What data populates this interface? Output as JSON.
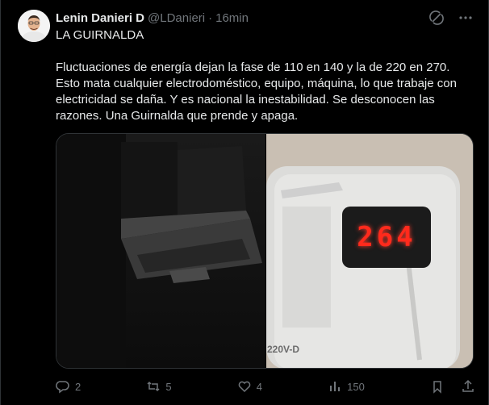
{
  "author": {
    "name": "Lenin Danieri D",
    "handle": "@LDanieri",
    "separator": "·",
    "time": "16min"
  },
  "tweet": {
    "title": "LA GUIRNALDA",
    "body": "Fluctuaciones de energía dejan la fase de 110 en 140 y la de 220 en 270. Esto mata cualquier electrodoméstico, equipo, máquina, lo que trabaje con electricidad se daña. Y es nacional la inestabilidad. Se desconocen las razones. Una Guirnalda que prende y apaga."
  },
  "media": {
    "meter_reading": "264",
    "device_label": "220V-D"
  },
  "actions": {
    "replies": "2",
    "retweets": "5",
    "likes": "4",
    "views": "150"
  },
  "icons": {
    "grok": "grok-icon",
    "more": "more-icon",
    "reply": "reply-icon",
    "retweet": "retweet-icon",
    "like": "heart-icon",
    "views": "views-icon",
    "bookmark": "bookmark-icon",
    "share": "share-icon"
  },
  "colors": {
    "background": "#000000",
    "text": "#e7e9ea",
    "muted": "#71767b",
    "meter_red": "#ff2a1c"
  }
}
